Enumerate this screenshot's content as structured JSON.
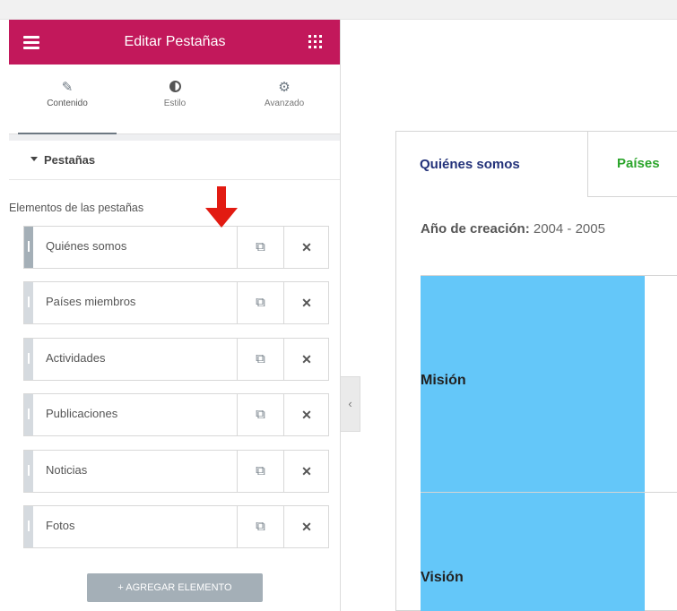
{
  "panel": {
    "title": "Editar Pestañas",
    "tabs": [
      {
        "label": "Contenido",
        "icon": "pencil-icon",
        "active": true
      },
      {
        "label": "Estilo",
        "icon": "contrast-icon",
        "active": false
      },
      {
        "label": "Avanzado",
        "icon": "gear-icon",
        "active": false
      }
    ],
    "section_title": "Pestañas",
    "items_label": "Elementos de las pestañas",
    "items": [
      {
        "label": "Quiénes somos"
      },
      {
        "label": "Países miembros"
      },
      {
        "label": "Actividades"
      },
      {
        "label": "Publicaciones"
      },
      {
        "label": "Noticias"
      },
      {
        "label": "Fotos"
      }
    ],
    "add_button": "+ AGREGAR ELEMENTO",
    "header_color": "#c2185b"
  },
  "preview": {
    "tabs": [
      "Quiénes somos",
      "Países"
    ],
    "year_label": "Año de creación:",
    "year_value": "2004 - 2005",
    "rows": [
      "Misión",
      "Visión"
    ],
    "cell_color": "#64c7f9"
  }
}
